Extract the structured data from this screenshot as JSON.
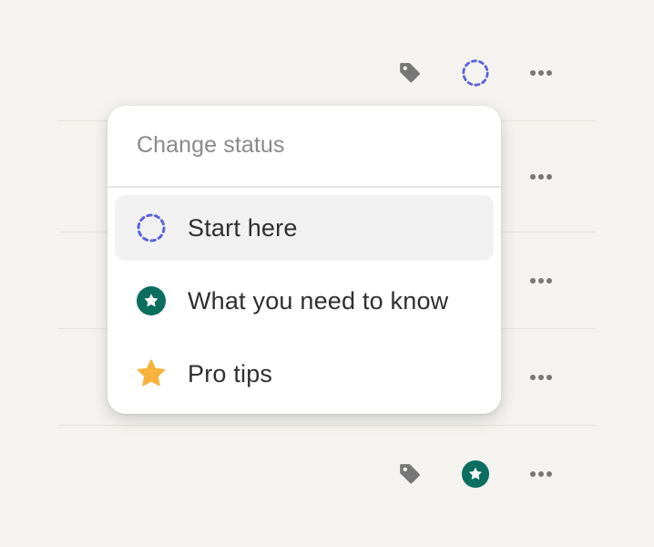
{
  "popup": {
    "title": "Change status",
    "items": [
      {
        "label": "Start here",
        "icon": "dashed-circle-icon",
        "highlighted": true
      },
      {
        "label": "What you need to know",
        "icon": "green-star-circle-icon",
        "highlighted": false
      },
      {
        "label": "Pro tips",
        "icon": "gold-star-icon",
        "highlighted": false
      }
    ]
  },
  "icons": {
    "tag": "tag-icon",
    "more": "more-horizontal-icon",
    "status_dashed": "dashed-circle-icon",
    "status_star": "green-star-circle-icon"
  },
  "colors": {
    "background": "#f4f3ef",
    "dashed_circle": "#5b63d8",
    "green": "#0b6e5f",
    "gold": "#f7b33e",
    "icon_gray": "#777777"
  }
}
